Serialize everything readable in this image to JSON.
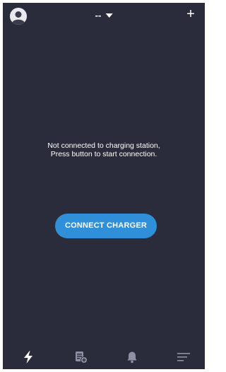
{
  "header": {
    "station_label": "--",
    "add_label": "+",
    "avatar_icon": "user-avatar-icon",
    "dropdown_icon": "caret-down-icon"
  },
  "main": {
    "message_line1": "Not connected to charging station,",
    "message_line2": "Press button to start connection.",
    "connect_label": "CONNECT CHARGER"
  },
  "bottom_nav": {
    "items": [
      {
        "icon": "lightning-icon",
        "active": true
      },
      {
        "icon": "document-add-icon",
        "active": false
      },
      {
        "icon": "bell-icon",
        "active": false
      },
      {
        "icon": "menu-icon",
        "active": false
      }
    ]
  },
  "colors": {
    "background": "#2b2c3b",
    "accent": "#2f8fd8",
    "icon_light": "#ffffff",
    "icon_muted": "#8e91a4"
  }
}
